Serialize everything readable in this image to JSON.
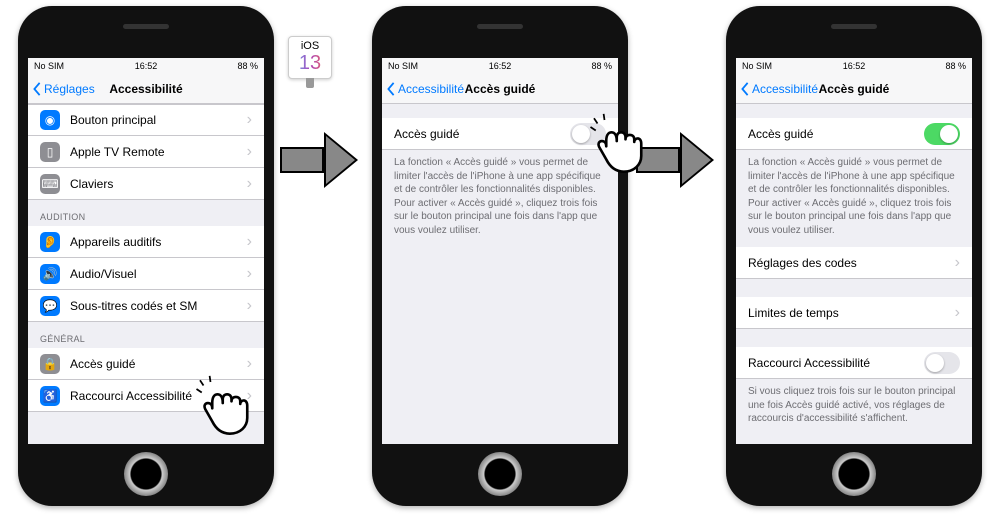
{
  "status": {
    "carrier": "No SIM",
    "wifi": "✓",
    "time": "16:52",
    "battery": "88 %"
  },
  "ios": {
    "label": "iOS",
    "version": "13"
  },
  "p1": {
    "back": "Réglages",
    "title": "Accessibilité",
    "items": [
      "Bouton principal",
      "Apple TV Remote",
      "Claviers"
    ],
    "sec2": "AUDITION",
    "items2": [
      "Appareils auditifs",
      "Audio/Visuel",
      "Sous-titres codés et SM"
    ],
    "sec3": "GÉNÉRAL",
    "items3": [
      "Accès guidé",
      "Raccourci Accessibilité"
    ]
  },
  "p2": {
    "back": "Accessibilité",
    "title": "Accès guidé",
    "row": "Accès guidé",
    "desc": "La fonction « Accès guidé » vous permet de limiter l'accès de l'iPhone à une app spécifique et de contrôler les fonctionnalités disponibles. Pour activer « Accès guidé », cliquez trois fois sur le bouton principal une fois dans l'app que vous voulez utiliser."
  },
  "p3": {
    "back": "Accessibilité",
    "title": "Accès guidé",
    "row1": "Accès guidé",
    "desc": "La fonction « Accès guidé » vous permet de limiter l'accès de l'iPhone à une app spécifique et de contrôler les fonctionnalités disponibles. Pour activer « Accès guidé », cliquez trois fois sur le bouton principal une fois dans l'app que vous voulez utiliser.",
    "row2": "Réglages des codes",
    "row3": "Limites de temps",
    "row4": "Raccourci Accessibilité",
    "desc2": "Si vous cliquez trois fois sur le bouton principal une fois Accès guidé activé, vos réglages de raccourcis d'accessibilité s'affichent."
  }
}
